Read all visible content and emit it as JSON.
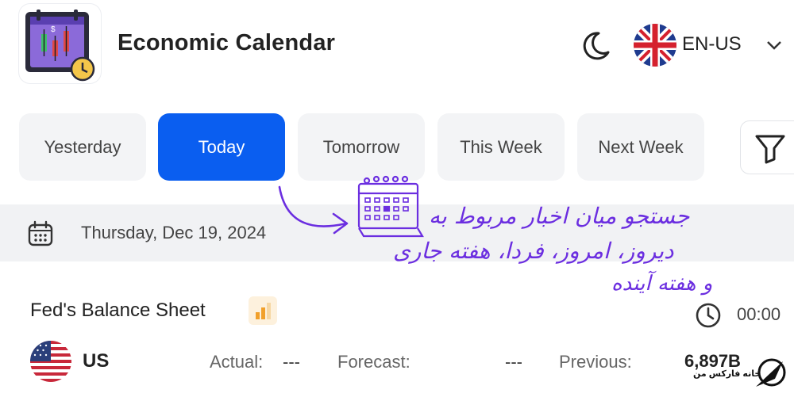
{
  "header": {
    "title": "Economic Calendar",
    "language": "EN-US",
    "icons": [
      "calendar-chart-logo",
      "moon-icon",
      "uk-flag-icon",
      "chevron-down-icon"
    ]
  },
  "tabs": [
    {
      "label": "Yesterday",
      "active": false
    },
    {
      "label": "Today",
      "active": true
    },
    {
      "label": "Tomorrow",
      "active": false
    },
    {
      "label": "This Week",
      "active": false
    },
    {
      "label": "Next Week",
      "active": false
    }
  ],
  "date_bar": {
    "date": "Thursday, Dec 19, 2024"
  },
  "event": {
    "title": "Fed's Balance Sheet",
    "time": "00:00",
    "country": "US",
    "actual_label": "Actual:",
    "actual_value": "---",
    "forecast_label": "Forecast:",
    "forecast_value": "---",
    "previous_label": "Previous:",
    "previous_value": "6,897B",
    "importance_bars": 2
  },
  "annotation": {
    "lines": [
      "جستجو میان اخبار مربوط به",
      "دیروز، امروز، فردا، هفته جاری",
      "و هفته آینده"
    ],
    "color": "#6b2ee0"
  },
  "watermark": {
    "text": "خانه فارکس من"
  },
  "colors": {
    "accent": "#0a5ef0",
    "tab_bg": "#f3f4f6",
    "date_bar_bg": "#f1f2f4",
    "annotation": "#6b2ee0"
  }
}
